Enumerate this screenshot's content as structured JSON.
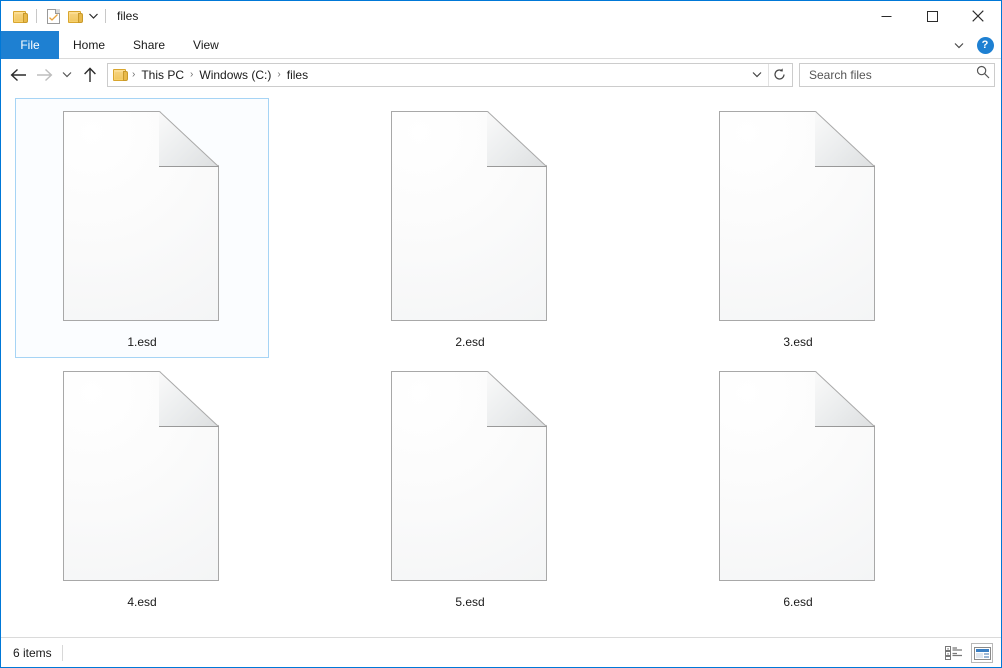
{
  "window": {
    "title": "files",
    "quick_access": [
      {
        "name": "folder-icon",
        "label": "Folder"
      },
      {
        "name": "properties-icon",
        "label": "Properties"
      },
      {
        "name": "new-folder-icon",
        "label": "New folder"
      },
      {
        "name": "chevron-down-icon",
        "label": "Customize Quick Access Toolbar"
      }
    ],
    "caption": {
      "minimize_label": "Minimize",
      "maximize_label": "Maximize",
      "close_label": "Close"
    }
  },
  "ribbon": {
    "tabs": [
      {
        "label": "File",
        "active": true
      },
      {
        "label": "Home",
        "active": false
      },
      {
        "label": "Share",
        "active": false
      },
      {
        "label": "View",
        "active": false
      }
    ],
    "collapse_label": "Minimize the Ribbon",
    "help_label": "?"
  },
  "address": {
    "back_label": "Back",
    "forward_label": "Forward",
    "recent_label": "Recent locations",
    "up_label": "Up",
    "crumbs": [
      "This PC",
      "Windows (C:)",
      "files"
    ],
    "separator": "›",
    "dropdown_label": "Previous locations",
    "refresh_label": "Refresh"
  },
  "search": {
    "placeholder": "Search files",
    "value": "",
    "icon": "search-icon"
  },
  "files": [
    {
      "name": "1.esd",
      "selected": true
    },
    {
      "name": "2.esd",
      "selected": false
    },
    {
      "name": "3.esd",
      "selected": false
    },
    {
      "name": "4.esd",
      "selected": false
    },
    {
      "name": "5.esd",
      "selected": false
    },
    {
      "name": "6.esd",
      "selected": false
    }
  ],
  "status": {
    "item_count": "6 items",
    "views": [
      {
        "name": "details-view-icon",
        "label": "Details view",
        "active": false
      },
      {
        "name": "large-icons-view-icon",
        "label": "Large icons view",
        "active": true
      }
    ]
  },
  "colors": {
    "accent": "#1e80d2",
    "window_border": "#0078d7",
    "selection_border": "#a6d4f5",
    "selection_fill": "#fbfdff",
    "folder_yellow": "#f6cf6a"
  }
}
